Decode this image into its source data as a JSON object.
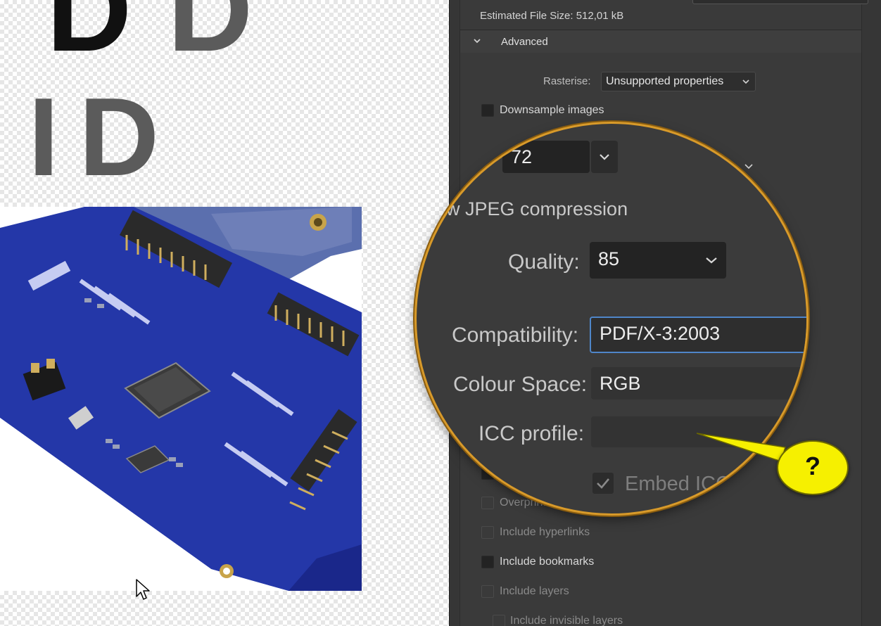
{
  "canvas": {
    "letters": [
      "D",
      "D",
      "I",
      "D"
    ]
  },
  "export_panel": {
    "estimated_file_size": "Estimated File Size: 512,01 kB",
    "advanced_section": {
      "title": "Advanced",
      "rasterise_label": "Rasterise:",
      "rasterise_value": "Unsupported properties",
      "downsample_label": "Downsample images",
      "options": [
        {
          "label": "Overprint",
          "checked": false,
          "enabled": false
        },
        {
          "label": "Include hyperlinks",
          "checked": false,
          "enabled": false
        },
        {
          "label": "Include bookmarks",
          "checked": false,
          "enabled": true
        },
        {
          "label": "Include layers",
          "checked": false,
          "enabled": false
        },
        {
          "label": "Include invisible layers",
          "checked": false,
          "enabled": false
        }
      ]
    }
  },
  "magnifier": {
    "dpi_value": "72",
    "jpeg_label": "w JPEG compression",
    "quality_label": "Quality:",
    "quality_value": "85",
    "compatibility_label": "Compatibility:",
    "compatibility_value": "PDF/X-3:2003",
    "colour_space_label": "Colour Space:",
    "colour_space_value": "RGB",
    "icc_profile_label": "ICC profile:",
    "icc_profile_value": "",
    "embed_icc_label": "Embed ICC"
  },
  "annotation": {
    "help_text": "?"
  },
  "colors": {
    "callout_ring": "#d89a2a",
    "help_bubble": "#f6f000",
    "pcb_blue": "#2437a8",
    "focus_border": "#4f86c9"
  }
}
